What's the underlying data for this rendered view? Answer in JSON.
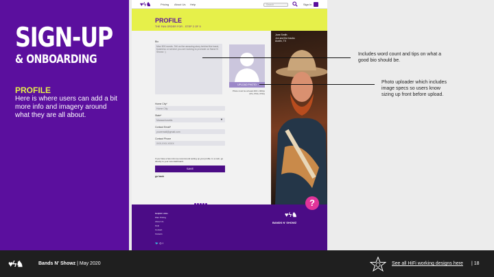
{
  "slide": {
    "title": "SIGN-UP",
    "subtitle": "& ONBOARDING",
    "section_heading": "PROFILE",
    "section_body": "Here is where users can add a bit more info and imagery around what they are all about."
  },
  "mockup": {
    "nav": {
      "logo": "♥ϟ♞",
      "links": [
        "Pricing",
        "About Us",
        "Help"
      ],
      "search_placeholder": "Search",
      "sign_in": "Sign In"
    },
    "header": {
      "title": "PROFILE",
      "step": "THE FAN ORDER FOR - STEP 2 OF 5"
    },
    "form": {
      "bio_label": "Bio",
      "bio_placeholder": "Max 500 words. Tell us the amazing story behind the band, business or service you are looking to promote on Band N Showz :)",
      "upload_button": "UPLOAD PHOTO",
      "photo_specs": "Photo must be at least 400 x 400px (PG, PNG, PNG)",
      "home_city_label": "Home City*",
      "home_city_placeholder": "Home City",
      "state_label": "State*",
      "state_value": "Massachusetts",
      "email_label": "Contact Email*",
      "email_placeholder": "youremail@gmail.com",
      "phone_label": "Contact Phone",
      "phone_placeholder": "XXX-XXX-XXXX",
      "hint": "If you have a few mins we recommend setting up your profile. In a rush, go directly to your new dashboard.",
      "save_button": "SAVE",
      "go_back": "go back"
    },
    "photo_caption": [
      "Jane Smith",
      "Jon and the tracks",
      "Austin, TX"
    ],
    "footer": {
      "links": [
        "Helpful Links",
        "Plan Pricing",
        "About Us",
        "Help",
        "Contact",
        "Careers"
      ],
      "brand": "BANDS N' SHOWZ",
      "logo": "♥ϟ♞",
      "help": "?"
    }
  },
  "annotations": {
    "bio_note": "Includes word count and tips on what a good bio should be.",
    "photo_note": "Photo uploader which includes image specs so users know sizing up front before upload."
  },
  "bottom_bar": {
    "logo": "♥ϟ♞",
    "brand": "Bands N' Showz",
    "date": "May 2020",
    "link": "See all HiFi working designs here",
    "page": "18"
  },
  "colors": {
    "purple": "#5b0f9e",
    "yellow": "#e6f04a",
    "dark": "#1f1f1f",
    "pink": "#e1349a"
  }
}
